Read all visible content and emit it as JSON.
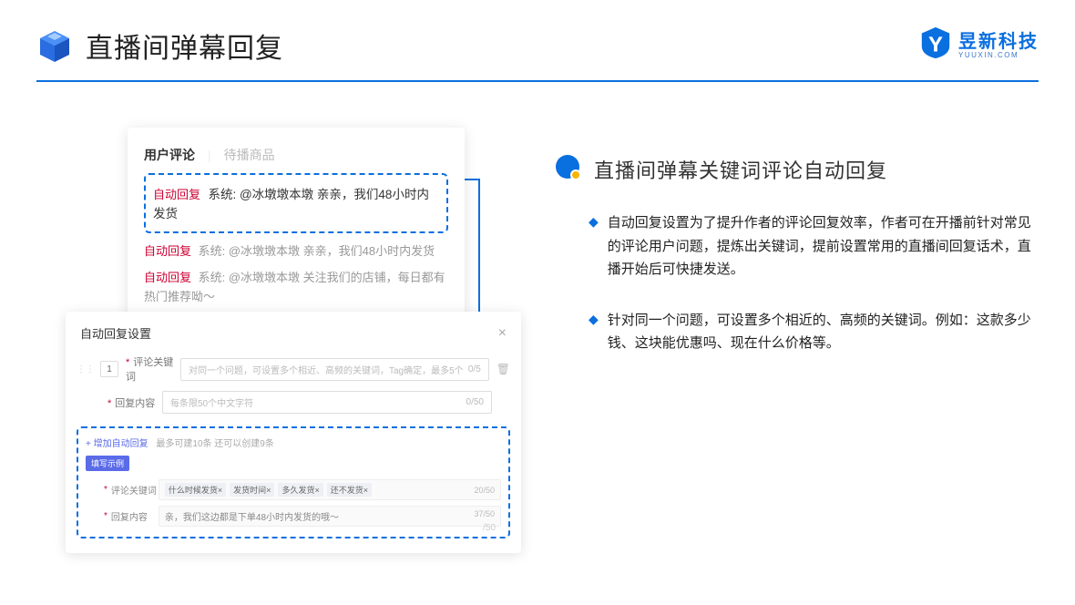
{
  "header": {
    "title": "直播间弹幕回复"
  },
  "brand": {
    "name": "昱新科技",
    "sub": "YUUXIN.COM"
  },
  "card1": {
    "tab_active": "用户评论",
    "tab_inactive": "待播商品",
    "highlighted": {
      "tag": "自动回复",
      "text": "系统: @冰墩墩本墩 亲亲，我们48小时内发货"
    },
    "line2": {
      "tag": "自动回复",
      "text": "系统: @冰墩墩本墩 亲亲，我们48小时内发货"
    },
    "line3": {
      "tag": "自动回复",
      "text": "系统: @冰墩墩本墩 关注我们的店铺，每日都有热门推荐呦～"
    }
  },
  "card2": {
    "title": "自动回复设置",
    "row_num": "1",
    "keyword_label": "评论关键词",
    "keyword_placeholder": "对同一个问题，可设置多个相近、高频的关键词，Tag确定，最多5个",
    "keyword_counter": "0/5",
    "content_label": "回复内容",
    "content_placeholder": "每条限50个中文字符",
    "content_counter": "0/50",
    "add_link": "+ 增加自动回复",
    "example_hint": "最多可建10条 还可以创建9条",
    "badge": "填写示例",
    "ex_keyword_label": "评论关键词",
    "ex_tags": [
      "什么时候发货×",
      "发货时间×",
      "多久发货×",
      "还不发货×"
    ],
    "ex_keyword_counter": "20/50",
    "ex_content_label": "回复内容",
    "ex_content_text": "亲，我们这边都是下单48小时内发货的哦～",
    "ex_content_counter": "37/50",
    "extra_counter": "/50"
  },
  "right": {
    "section_title": "直播间弹幕关键词评论自动回复",
    "bullet1": "自动回复设置为了提升作者的评论回复效率，作者可在开播前针对常见的评论用户问题，提炼出关键词，提前设置常用的直播间回复话术，直播开始后可快捷发送。",
    "bullet2": "针对同一个问题，可设置多个相近的、高频的关键词。例如：这款多少钱、这块能优惠吗、现在什么价格等。"
  }
}
